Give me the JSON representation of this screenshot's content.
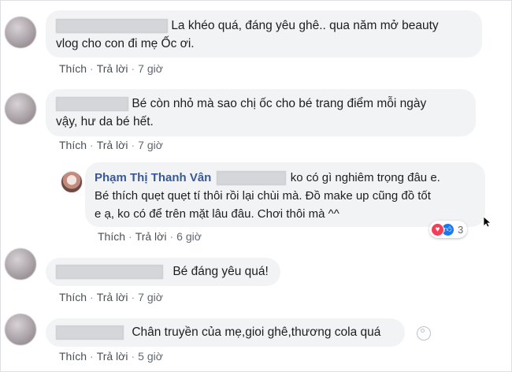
{
  "comments": [
    {
      "text_line1": "La khéo quá, đáng yêu ghê.. qua năm mở beauty",
      "text_line2": "vlog cho con đi mẹ Ốc ơi.",
      "like": "Thích",
      "reply": "Trả lời",
      "time": "7 giờ"
    },
    {
      "text_line1": "Bé còn nhỏ mà sao chị ốc cho bé trang điểm mỗi ngày",
      "text_line2": "vậy, hư da bé hết.",
      "like": "Thích",
      "reply": "Trả lời",
      "time": "7 giờ"
    },
    {
      "author": "Phạm Thị Thanh Vân",
      "text_line1": "ko có gì nghiêm trọng đâu e.",
      "text_line2": "Bé thích quẹt quẹt tí thôi rồi lại chùi mà. Đồ make up cũng đồ tốt",
      "text_line3": "e ạ, ko có để trên mặt lâu đâu. Chơi thôi mà ^^",
      "like": "Thích",
      "reply": "Trả lời",
      "time": "6 giờ",
      "reactions": {
        "count": "3",
        "icons": [
          "heart-icon",
          "like-icon"
        ],
        "colors": [
          "#f33e58",
          "#1877f2"
        ]
      }
    },
    {
      "text_line1": "Bé đáng yêu quá!",
      "like": "Thích",
      "reply": "Trả lời",
      "time": "7 giờ"
    },
    {
      "text_line1": "Chân truyền của mẹ,gioi ghê,thương cola quá",
      "like": "Thích",
      "reply": "Trả lời",
      "time": "5 giờ"
    }
  ]
}
